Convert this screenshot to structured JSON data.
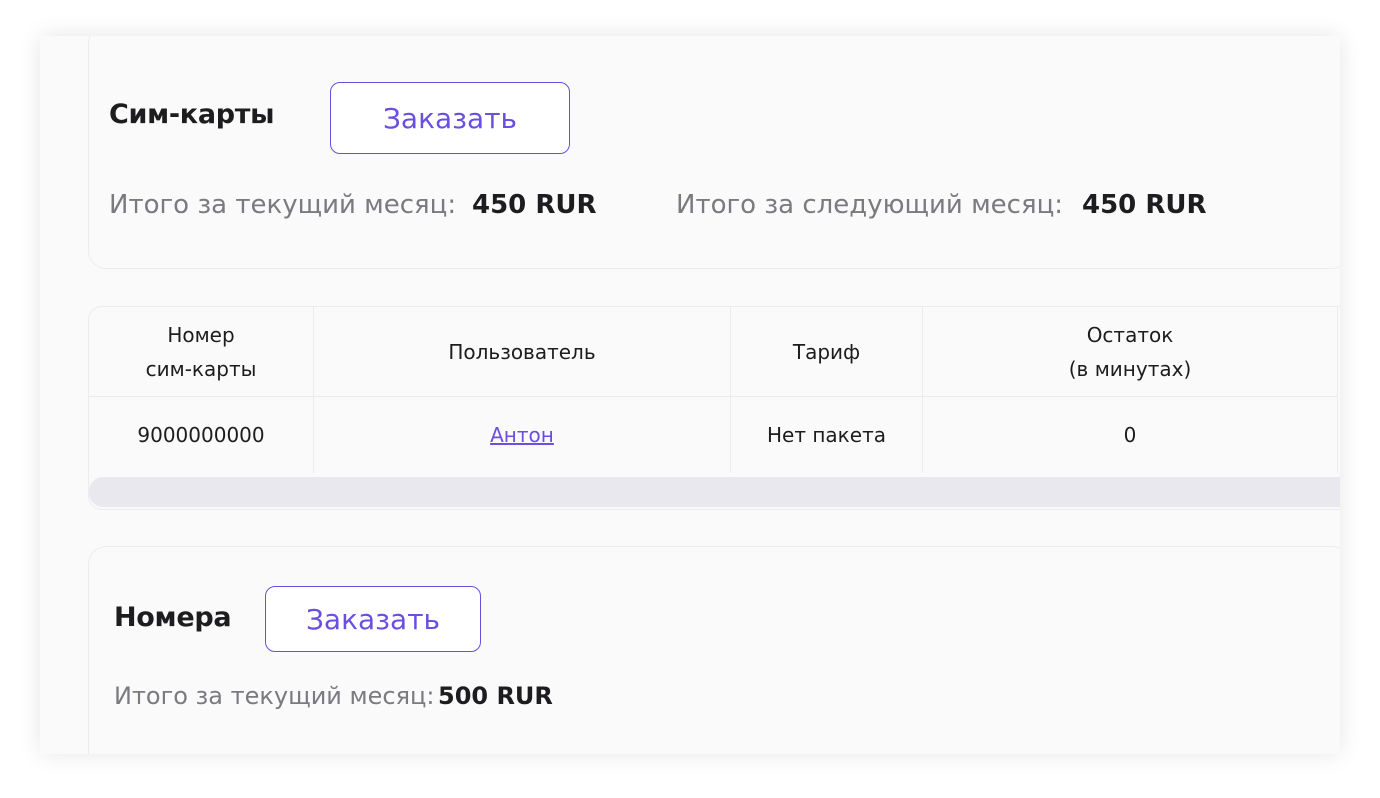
{
  "sim_section": {
    "title": "Сим-карты",
    "order_label": "Заказать",
    "current_month_label": "Итого за текущий месяц:",
    "current_month_value": "450 RUR",
    "next_month_label": "Итого за следующий месяц:",
    "next_month_value": "450 RUR"
  },
  "table": {
    "headers": [
      "Номер\nсим-карты",
      "Пользователь",
      "Тариф",
      "Остаток\n(в минутах)"
    ],
    "rows": [
      [
        "9000000000",
        "Антон",
        "Нет пакета",
        "0"
      ]
    ]
  },
  "numbers_section": {
    "title": "Номера",
    "order_label": "Заказать",
    "current_month_label": "Итого за текущий месяц:",
    "current_month_value": "500 RUR"
  },
  "colors": {
    "accent": "#6a4fe0",
    "text": "#1d1d1f",
    "muted": "#7a7a80"
  }
}
